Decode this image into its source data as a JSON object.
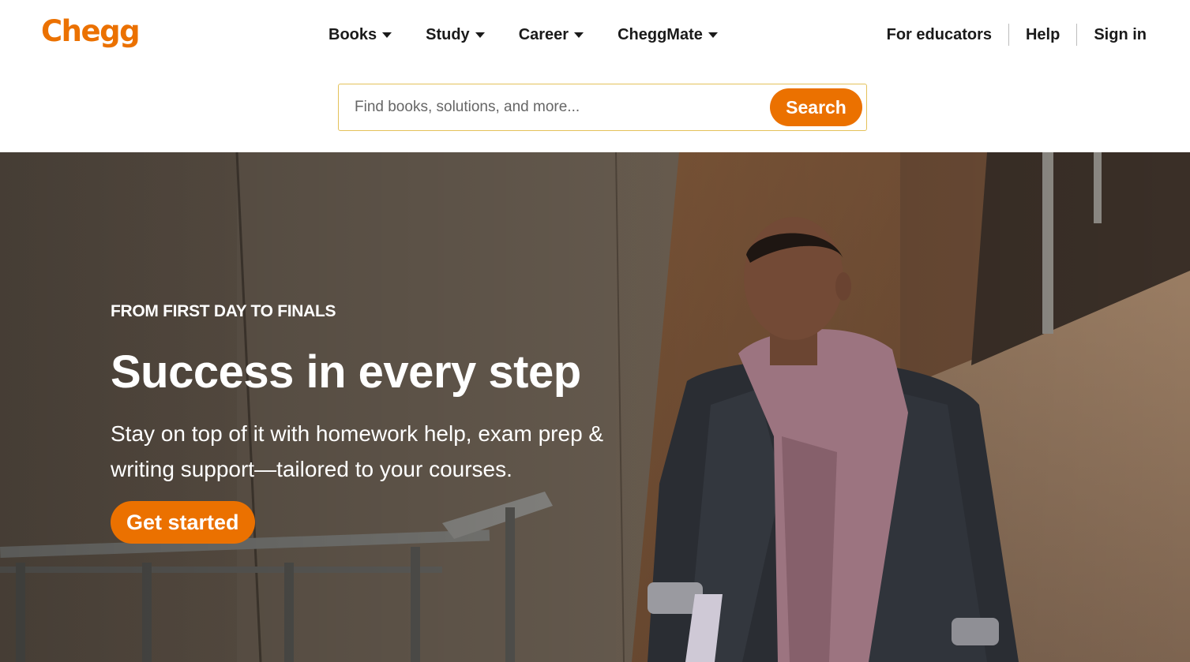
{
  "brand": {
    "logo_text": "Chegg",
    "accent_color": "#eb7100"
  },
  "nav": {
    "items": [
      {
        "label": "Books",
        "icon": "chevron-down-icon"
      },
      {
        "label": "Study",
        "icon": "chevron-down-icon"
      },
      {
        "label": "Career",
        "icon": "chevron-down-icon"
      },
      {
        "label": "CheggMate",
        "icon": "chevron-down-icon"
      }
    ],
    "right_links": [
      "For educators",
      "Help",
      "Sign in"
    ]
  },
  "search": {
    "placeholder": "Find books, solutions, and more...",
    "value": "",
    "button_label": "Search"
  },
  "hero": {
    "eyebrow": "FROM FIRST DAY TO FINALS",
    "headline": "Success in every step",
    "subtext": "Stay on top of it with homework help, exam prep & writing support—tailored to your courses.",
    "cta_label": "Get started",
    "image": "student-walking-upstairs-photo"
  }
}
